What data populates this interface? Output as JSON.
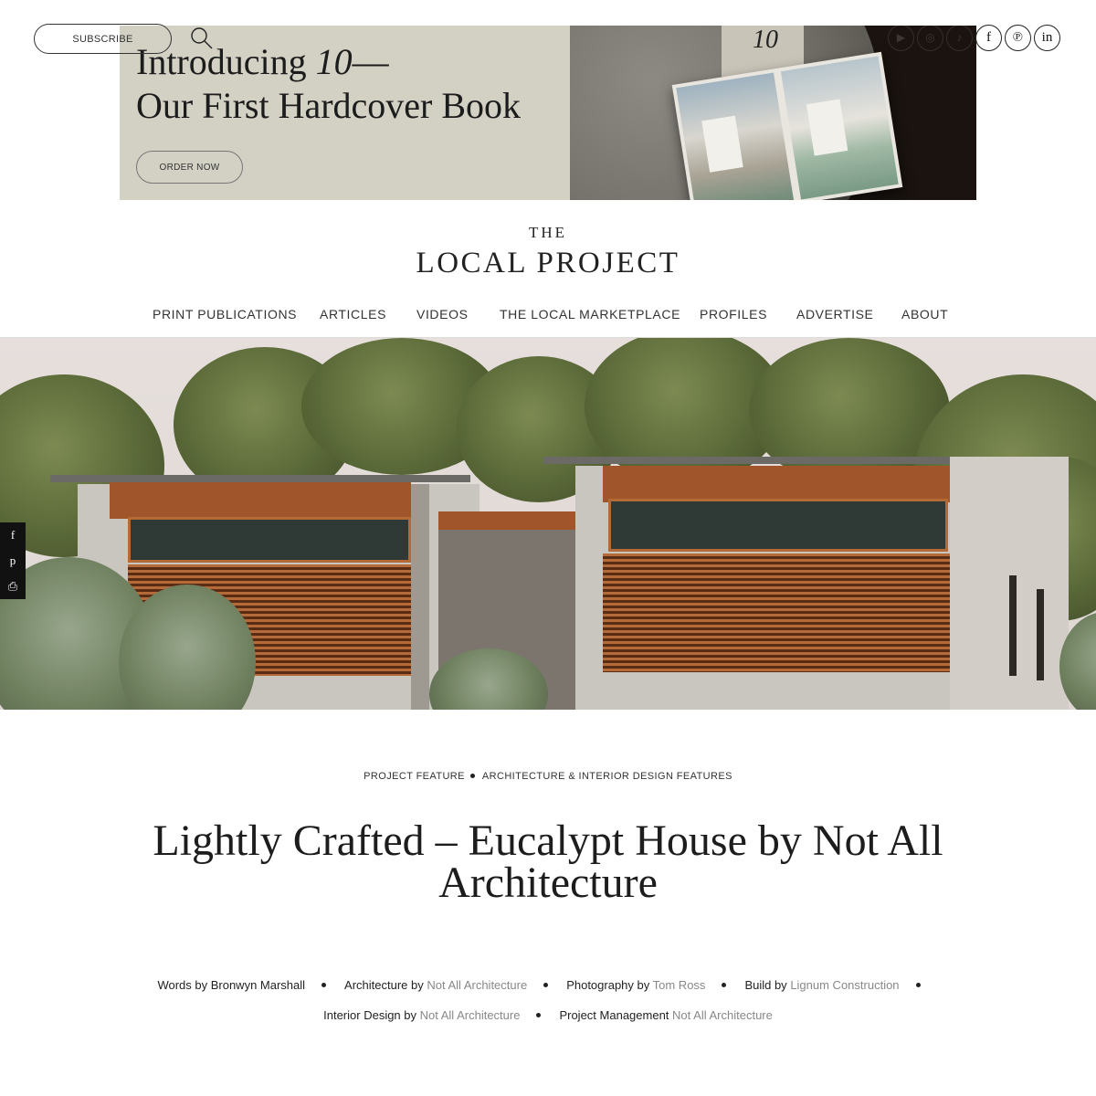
{
  "header": {
    "subscribe_label": "SUBSCRIBE",
    "search_icon": "search-icon",
    "social_icons": [
      "youtube-icon",
      "instagram-icon",
      "tiktok-icon",
      "facebook-icon",
      "pinterest-icon",
      "linkedin-icon"
    ],
    "social_glyphs": [
      "▶",
      "◎",
      "♪",
      "f",
      "℗",
      "in"
    ]
  },
  "promo": {
    "headline_line1_a": "Introducing ",
    "headline_num": "10",
    "headline_line1_b": "—",
    "headline_line2": "Our First Hardcover Book",
    "order_label": "ORDER NOW",
    "book_number": "10",
    "bg_color": "#d2d1c4"
  },
  "logo": {
    "the": "THE",
    "name": "LOCAL PROJECT"
  },
  "nav": {
    "items": [
      "PRINT PUBLICATIONS",
      "ARTICLES",
      "VIDEOS",
      "THE LOCAL MARKETPLACE",
      "PROFILES",
      "ADVERTISE",
      "ABOUT"
    ]
  },
  "share": {
    "items": [
      {
        "icon": "facebook-icon",
        "glyph": "f"
      },
      {
        "icon": "pinterest-icon",
        "glyph": "p"
      },
      {
        "icon": "print-icon",
        "glyph": "⎙"
      }
    ]
  },
  "article": {
    "categories": [
      "PROJECT FEATURE",
      "ARCHITECTURE & INTERIOR DESIGN FEATURES"
    ],
    "title": "Lightly Crafted – Eucalypt House by Not All Architecture",
    "credits_row1": [
      {
        "label": "Words by Bronwyn Marshall",
        "value": ""
      },
      {
        "label": "Architecture by ",
        "value": "Not All Architecture"
      },
      {
        "label": "Photography by ",
        "value": "Tom Ross"
      },
      {
        "label": "Build by ",
        "value": "Lignum Construction"
      }
    ],
    "credits_row2": [
      {
        "label": "Interior Design by ",
        "value": "Not All Architecture"
      },
      {
        "label": "Project Management ",
        "value": "Not All Architecture"
      }
    ],
    "link_color": "#888888"
  }
}
